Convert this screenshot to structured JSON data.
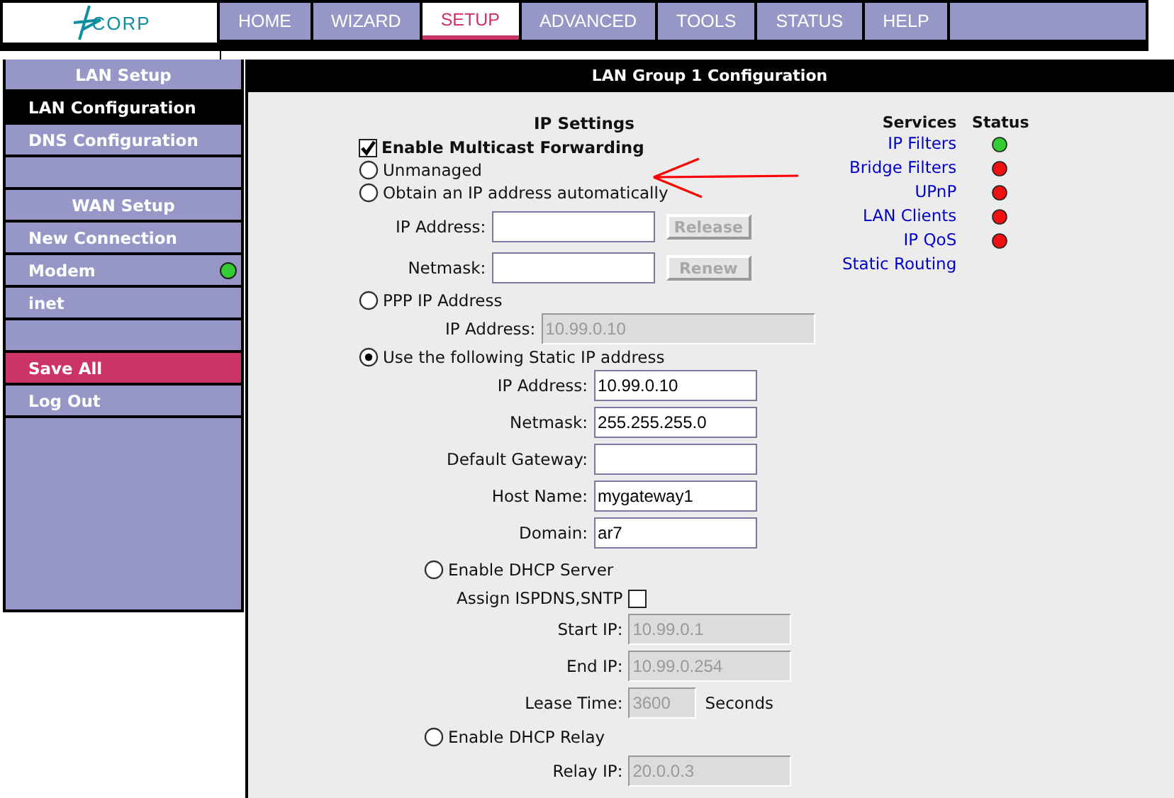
{
  "logo": {
    "text": "CORP"
  },
  "nav": [
    {
      "label": "HOME",
      "selected": false
    },
    {
      "label": "WIZARD",
      "selected": false
    },
    {
      "label": "SETUP",
      "selected": true
    },
    {
      "label": "ADVANCED",
      "selected": false
    },
    {
      "label": "TOOLS",
      "selected": false
    },
    {
      "label": "STATUS",
      "selected": false
    },
    {
      "label": "HELP",
      "selected": false
    }
  ],
  "sidebar": {
    "items": [
      {
        "kind": "header",
        "label": "LAN Setup"
      },
      {
        "kind": "link",
        "label": "LAN Configuration",
        "selected": true
      },
      {
        "kind": "link",
        "label": "DNS Configuration",
        "selected": false
      },
      {
        "kind": "spacer"
      },
      {
        "kind": "header",
        "label": "WAN Setup"
      },
      {
        "kind": "link",
        "label": "New Connection",
        "selected": false
      },
      {
        "kind": "link",
        "label": "Modem",
        "selected": false,
        "color": "#33cc33"
      },
      {
        "kind": "link",
        "label": "inet",
        "selected": false
      },
      {
        "kind": "spacer"
      },
      {
        "kind": "action",
        "label": "Save All"
      },
      {
        "kind": "link",
        "label": "Log Out",
        "selected": false
      }
    ]
  },
  "panel": {
    "title": "LAN Group 1 Configuration",
    "ip_settings": {
      "heading": "IP Settings",
      "multicast": {
        "label": "Enable Multicast Forwarding",
        "checked": true
      },
      "options": [
        {
          "label": "Unmanaged",
          "selected": false
        },
        {
          "label": "Obtain an IP address automatically",
          "selected": false,
          "fields": [
            {
              "label": "IP Address:",
              "button": {
                "label": "Release",
                "disabled": true
              }
            },
            {
              "label": "Netmask:",
              "button": {
                "label": "Renew",
                "disabled": true
              }
            }
          ]
        },
        {
          "label": "PPP IP Address",
          "selected": false,
          "fields": [
            {
              "label": "IP Address:",
              "value": "10.99.0.10",
              "disabled": true
            }
          ]
        },
        {
          "label": "Use the following Static IP address",
          "selected": true,
          "fields": [
            {
              "label": "IP Address:",
              "value": "10.99.0.10",
              "disabled": false
            },
            {
              "label": "Netmask:",
              "value": "255.255.255.0",
              "disabled": false
            },
            {
              "label": "Default Gateway:",
              "disabled": false
            },
            {
              "label": "Host Name:",
              "value": "mygateway1",
              "disabled": false
            },
            {
              "label": "Domain:",
              "value": "ar7",
              "disabled": false
            }
          ],
          "dhcp": [
            {
              "label": "Enable DHCP Server",
              "selected": false,
              "assign": {
                "label": "Assign ISPDNS,SNTP",
                "checked": false
              },
              "fields": [
                {
                  "label": "Start IP:",
                  "value": "10.99.0.1",
                  "disabled": true
                },
                {
                  "label": "End IP:",
                  "value": "10.99.0.254",
                  "disabled": true
                },
                {
                  "label": "Lease Time:",
                  "value": "3600",
                  "disabled": true,
                  "unit": "Seconds"
                }
              ]
            },
            {
              "label": "Enable DHCP Relay",
              "selected": false,
              "fields": [
                {
                  "label": "Relay IP:",
                  "value": "20.0.0.3",
                  "disabled": true
                }
              ]
            }
          ]
        }
      ]
    },
    "services": {
      "heading": "Services",
      "status_heading": "Status",
      "items": [
        {
          "name": "IP Filters",
          "color": "#33cc33"
        },
        {
          "name": "Bridge Filters",
          "color": "#ee1111"
        },
        {
          "name": "UPnP",
          "color": "#ee1111"
        },
        {
          "name": "LAN Clients",
          "color": "#ee1111"
        },
        {
          "name": "IP QoS",
          "color": "#ee1111"
        },
        {
          "name": "Static Routing"
        }
      ]
    }
  }
}
